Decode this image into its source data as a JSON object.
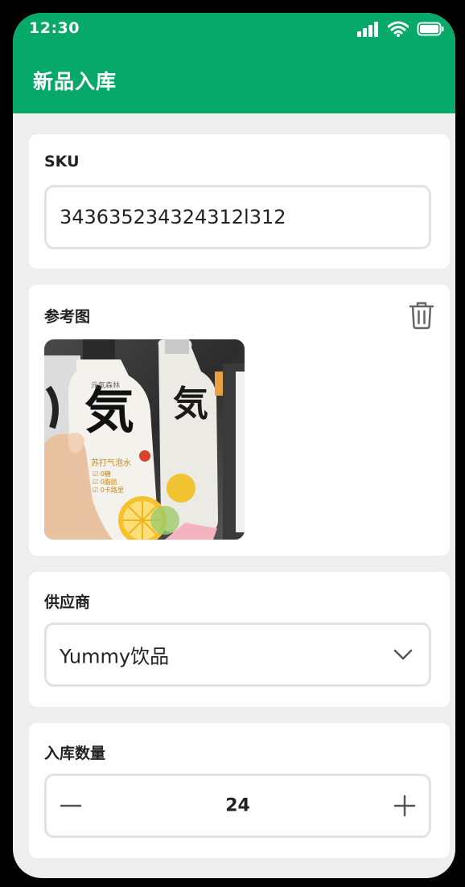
{
  "status": {
    "time": "12:30"
  },
  "header": {
    "title": "新品入库"
  },
  "sku": {
    "label": "SKU",
    "value": "343635234324312l312"
  },
  "reference": {
    "label": "参考图",
    "image_text": [
      "元気森林",
      "気",
      "苏打气泡水",
      "0糖",
      "0脂肪",
      "0卡路里"
    ]
  },
  "supplier": {
    "label": "供应商",
    "selected": "Yummy饮品"
  },
  "quantity": {
    "label": "入库数量",
    "value": "24"
  },
  "colors": {
    "accent": "#06a96a",
    "background": "#eeeeee"
  }
}
